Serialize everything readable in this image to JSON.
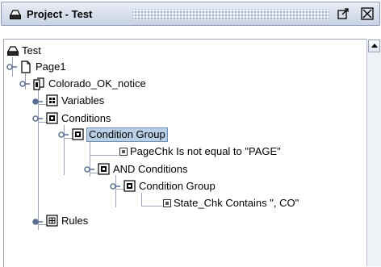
{
  "window": {
    "title": "Project - Test"
  },
  "tree": {
    "root": "Test",
    "page": "Page1",
    "notice": "Colorado_OK_notice",
    "variables": "Variables",
    "conditions": "Conditions",
    "condition_group": "Condition Group",
    "page_check": "PageChk Is not equal to \"PAGE\"",
    "and_conditions": "AND Conditions",
    "inner_condition_group": "Condition Group",
    "state_check": "State_Chk Contains \", CO\"",
    "rules": "Rules"
  },
  "icons": {
    "project": "printer-icon",
    "page": "page-icon",
    "notice": "document-copy-icon",
    "variables": "variables-icon",
    "conditions": "condition-icon",
    "condition_item": "condition-item-icon",
    "rules": "rules-icon"
  },
  "colors": {
    "selection_bg": "#b8cfe5",
    "titlebar_start": "#e9edf5",
    "titlebar_end": "#c9d3e4"
  }
}
